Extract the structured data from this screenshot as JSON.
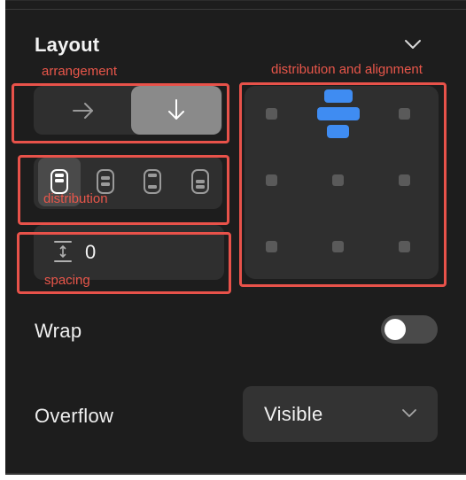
{
  "panel": {
    "title": "Layout",
    "collapse_icon": "chevron-down-icon"
  },
  "annotations": {
    "arrangement": "arrangement",
    "distribution": "distribution",
    "spacing": "spacing",
    "distribution_alignment": "distribution and alignment",
    "color": "#e8524a"
  },
  "arrangement": {
    "options": [
      {
        "icon": "arrow-right-icon",
        "selected": false
      },
      {
        "icon": "arrow-down-icon",
        "selected": true
      }
    ]
  },
  "distribution": {
    "options": [
      {
        "icon": "distribution-start-icon",
        "selected": true
      },
      {
        "icon": "distribution-center-icon",
        "selected": false
      },
      {
        "icon": "distribution-space-between-icon",
        "selected": false
      },
      {
        "icon": "distribution-end-icon",
        "selected": false
      }
    ]
  },
  "spacing": {
    "icon": "vertical-spacing-icon",
    "value": "0"
  },
  "alignment_grid": {
    "rows": 3,
    "cols": 3,
    "selected": "top-center",
    "accent_color": "#3f8cf2"
  },
  "wrap": {
    "label": "Wrap",
    "enabled": false
  },
  "overflow": {
    "label": "Overflow",
    "value": "Visible",
    "icon": "chevron-down-icon"
  }
}
